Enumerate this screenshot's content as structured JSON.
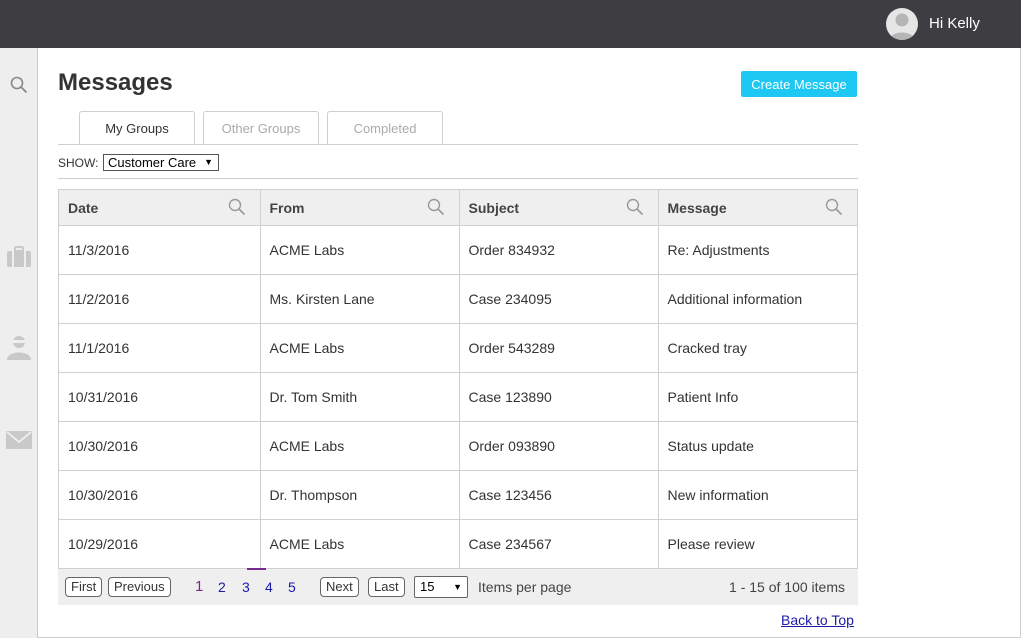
{
  "header": {
    "greeting": "Hi Kelly"
  },
  "sidebar": {
    "icons": [
      "search-icon",
      "briefcase-icon",
      "user-icon",
      "mail-icon"
    ]
  },
  "page": {
    "title": "Messages",
    "create_label": "Create Message"
  },
  "tabs": [
    {
      "label": "My Groups",
      "active": true
    },
    {
      "label": "Other Groups",
      "active": false
    },
    {
      "label": "Completed",
      "active": false
    }
  ],
  "filter": {
    "show_label": "SHOW:",
    "selected": "Customer Care"
  },
  "table": {
    "columns": [
      "Date",
      "From",
      "Subject",
      "Message"
    ],
    "rows": [
      [
        "11/3/2016",
        "ACME Labs",
        "Order 834932",
        "Re: Adjustments"
      ],
      [
        "11/2/2016",
        "Ms. Kirsten Lane",
        "Case 234095",
        "Additional information"
      ],
      [
        "11/1/2016",
        "ACME Labs",
        "Order 543289",
        "Cracked tray"
      ],
      [
        "10/31/2016",
        "Dr. Tom Smith",
        "Case 123890",
        "Patient Info"
      ],
      [
        "10/30/2016",
        "ACME Labs",
        "Order 093890",
        "Status update"
      ],
      [
        "10/30/2016",
        "Dr. Thompson",
        "Case 123456",
        "New information"
      ],
      [
        "10/29/2016",
        "ACME Labs",
        "Case 234567",
        "Please review"
      ]
    ]
  },
  "pager": {
    "first": "First",
    "previous": "Previous",
    "next": "Next",
    "last": "Last",
    "pages": [
      "1",
      "2",
      "3",
      "4",
      "5"
    ],
    "current_page": "1",
    "page_size": "15",
    "items_per_page": "Items per page",
    "summary": "1 - 15 of 100 items"
  },
  "footer": {
    "back_to_top": "Back to Top"
  },
  "colors": {
    "topbar": "#3e3d42",
    "accent": "#1fc8f2",
    "link": "#1a1aa6",
    "current_page": "#7a2a8a"
  }
}
